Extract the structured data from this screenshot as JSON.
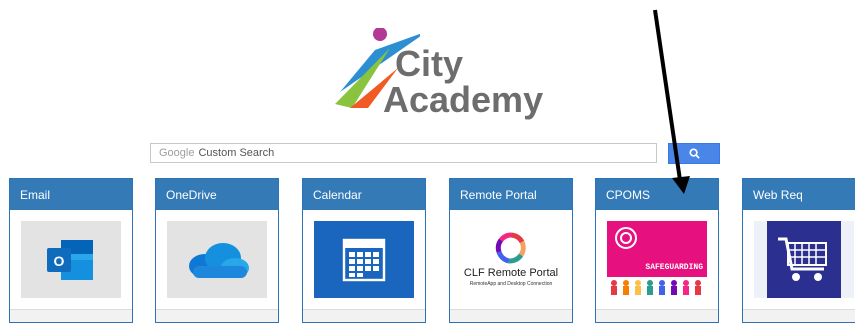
{
  "logo": {
    "line1": "City",
    "line2": "Academy",
    "colors": {
      "purple": "#b33a94",
      "blue": "#2c8fd2",
      "green": "#8ac43f",
      "orange": "#f15a24",
      "text": "#6d6d6d"
    }
  },
  "search": {
    "brand": "Google",
    "placeholder": "Custom Search",
    "button_icon": "search-icon"
  },
  "cards": [
    {
      "title": "Email",
      "icon": "outlook-icon"
    },
    {
      "title": "OneDrive",
      "icon": "onedrive-cloud-icon"
    },
    {
      "title": "Calendar",
      "icon": "calendar-icon"
    },
    {
      "title": "Remote Portal",
      "icon": "clf-remote-portal-logo",
      "logo_title": "CLF Remote Portal",
      "logo_subtitle": "RemoteApp and Desktop Connection"
    },
    {
      "title": "CPOMS",
      "icon": "safeguarding-icon",
      "badge": "SAFEGUARDING"
    },
    {
      "title": "Web Req",
      "icon": "shopping-cart-icon"
    }
  ],
  "colors": {
    "header": "#337ab7",
    "search_button": "#4a86e8"
  }
}
